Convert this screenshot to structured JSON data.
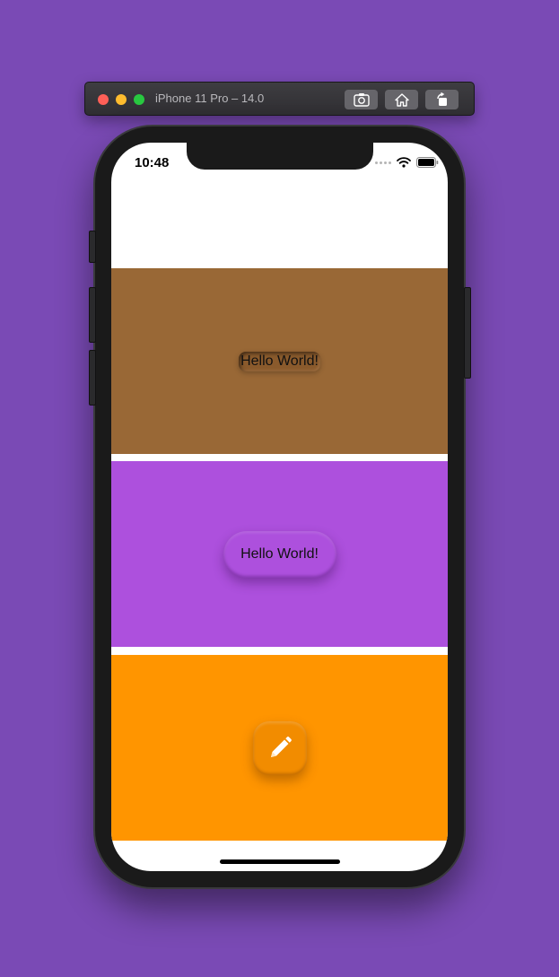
{
  "simulator": {
    "title": "iPhone 11 Pro – 14.0",
    "buttons": [
      {
        "icon": "screenshot-camera-icon"
      },
      {
        "icon": "home-icon"
      },
      {
        "icon": "rotate-icon"
      }
    ]
  },
  "status_bar": {
    "time": "10:48",
    "icons": [
      "cellular-signal-icon",
      "wifi-icon",
      "battery-icon"
    ]
  },
  "panels": [
    {
      "color": "#996836",
      "button_label": "Hello World!",
      "style": "inset"
    },
    {
      "color": "#ad50dd",
      "button_label": "Hello World!",
      "style": "raised"
    },
    {
      "color": "#ff9500",
      "button_icon": "pencil-icon",
      "style": "raised-square"
    }
  ],
  "colors": {
    "background": "#7a4ab5",
    "brown": "#996836",
    "purple": "#ad50dd",
    "orange": "#ff9500"
  }
}
